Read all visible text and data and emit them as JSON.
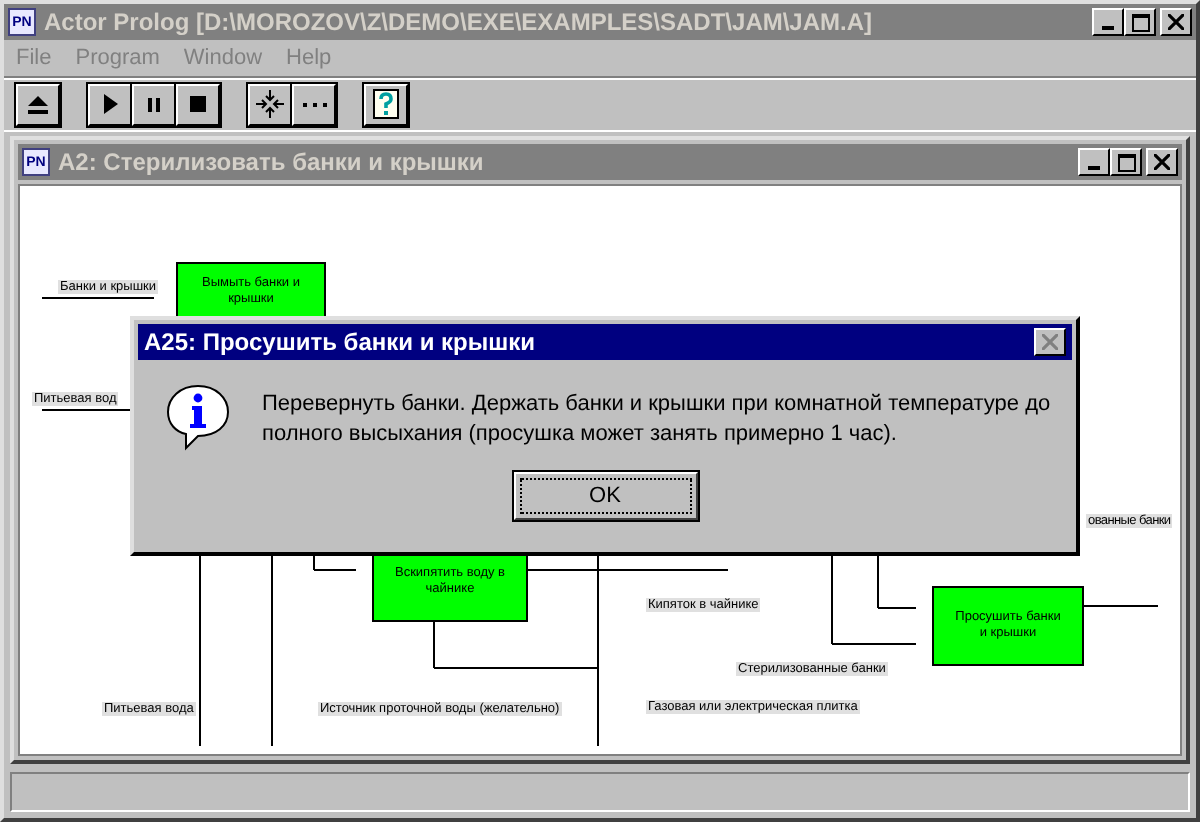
{
  "window": {
    "icon_text": "PN",
    "title": "Actor Prolog [D:\\MOROZOV\\Z\\DEMO\\EXE\\EXAMPLES\\SADT\\JAM\\JAM.A]"
  },
  "menu": [
    "File",
    "Program",
    "Window",
    "Help"
  ],
  "toolbar": [
    {
      "kind": "eject"
    },
    {
      "kind": "play"
    },
    {
      "kind": "pause"
    },
    {
      "kind": "stop"
    },
    {
      "kind": "arrows"
    },
    {
      "kind": "more"
    },
    {
      "kind": "help"
    }
  ],
  "child_window": {
    "icon_text": "PN",
    "title": "A2: Стерилизовать банки и крышки",
    "boxes": [
      "Вымыть банки и крышки",
      "Вскипятить воду в чайнике",
      "Просушить банки и крышки"
    ],
    "labels": [
      "Банки и крышки",
      "Питьевая вод",
      "Питьевая вода",
      "Источник проточной воды (желательно)",
      "Кипяток в чайнике",
      "Стерилизованные банки",
      "Газовая или электрическая плитка",
      "ованные банки"
    ]
  },
  "dialog": {
    "title": "A25: Просушить банки и крышки",
    "message": "Перевернуть банки. Держать банки и крышки при комнатной температуре до полного высыхания (просушка может занять примерно 1 час).",
    "buttons": [
      "OK"
    ]
  }
}
